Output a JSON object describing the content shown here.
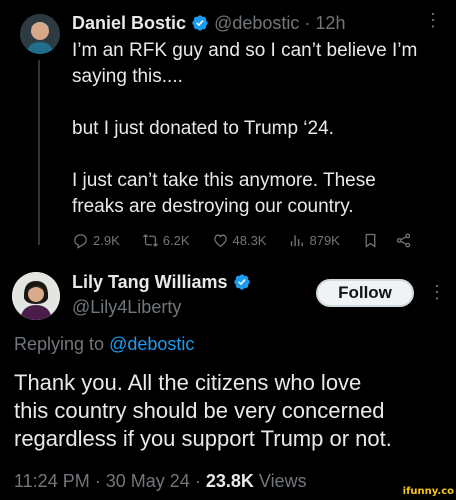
{
  "tweet1": {
    "display_name": "Daniel Bostic",
    "handle": "@debostic",
    "time": "12h",
    "lines": [
      "I’m an RFK guy and so I can’t believe I’m",
      "saying this....",
      "but I just donated to Trump ‘24.",
      "I just can’t take this anymore. These",
      "freaks are destroying our country."
    ],
    "stats": {
      "replies": "2.9K",
      "retweets": "6.2K",
      "likes": "48.3K",
      "views": "879K"
    }
  },
  "tweet2": {
    "display_name": "Lily Tang Williams",
    "handle": "@Lily4Liberty",
    "follow_label": "Follow",
    "replying_prefix": "Replying to",
    "replying_handle": "@debostic",
    "lines": [
      "Thank you. All the citizens who love",
      "this country should be very concerned",
      "regardless if you support Trump or not."
    ],
    "meta": {
      "time": "11:24 PM",
      "date": "30 May 24",
      "views_count": "23.8K",
      "views_label": "Views"
    }
  },
  "watermark": "ifunny.co",
  "colors": {
    "background": "#000000",
    "text": "#e7e9ea",
    "muted": "#71767b",
    "link": "#1d9bf0",
    "verified": "#1d9bf0"
  }
}
